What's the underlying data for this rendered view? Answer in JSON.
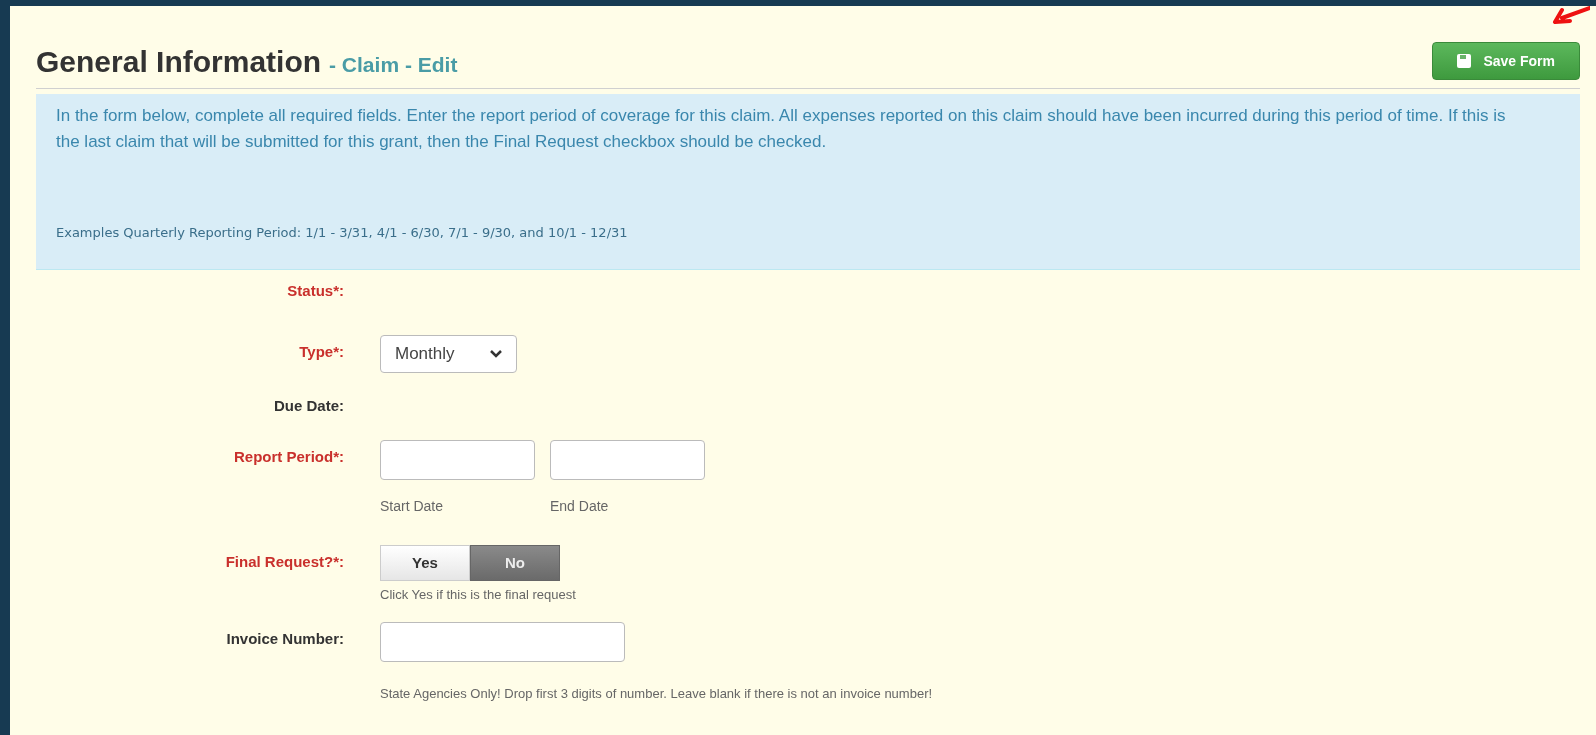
{
  "header": {
    "title": "General Information",
    "subtitle": "- Claim - Edit",
    "save_button": "Save Form"
  },
  "info": {
    "text": "In the form below, complete all required fields. Enter the report period of coverage for this claim. All expenses reported on this claim should have been incurred during this period of time. If this is the last claim that will be submitted for this grant, then the Final Request checkbox should be checked.",
    "note": "Examples Quarterly Reporting Period: 1/1 - 3/31, 4/1 - 6/30, 7/1 - 9/30, and 10/1 - 12/31"
  },
  "fields": [
    {
      "kind": "static",
      "label": "Status*:",
      "required": true
    },
    {
      "kind": "select",
      "label": "Type*:",
      "required": true,
      "value": "Monthly"
    },
    {
      "kind": "static",
      "label": "Due Date:",
      "required": false
    },
    {
      "kind": "range",
      "label": "Report Period*:",
      "required": true,
      "captions": [
        "Start Date",
        "End Date"
      ]
    },
    {
      "kind": "toggle",
      "label": "Final Request?*:",
      "required": true,
      "options": [
        {
          "label": "Yes",
          "selected": false
        },
        {
          "label": "No",
          "selected": true
        }
      ],
      "hint": "Click Yes if this is the final request"
    },
    {
      "kind": "input",
      "label": "Invoice Number:",
      "required": false,
      "hint": "State Agencies Only! Drop first 3 digits of number. Leave blank if there is not an invoice number!"
    }
  ]
}
